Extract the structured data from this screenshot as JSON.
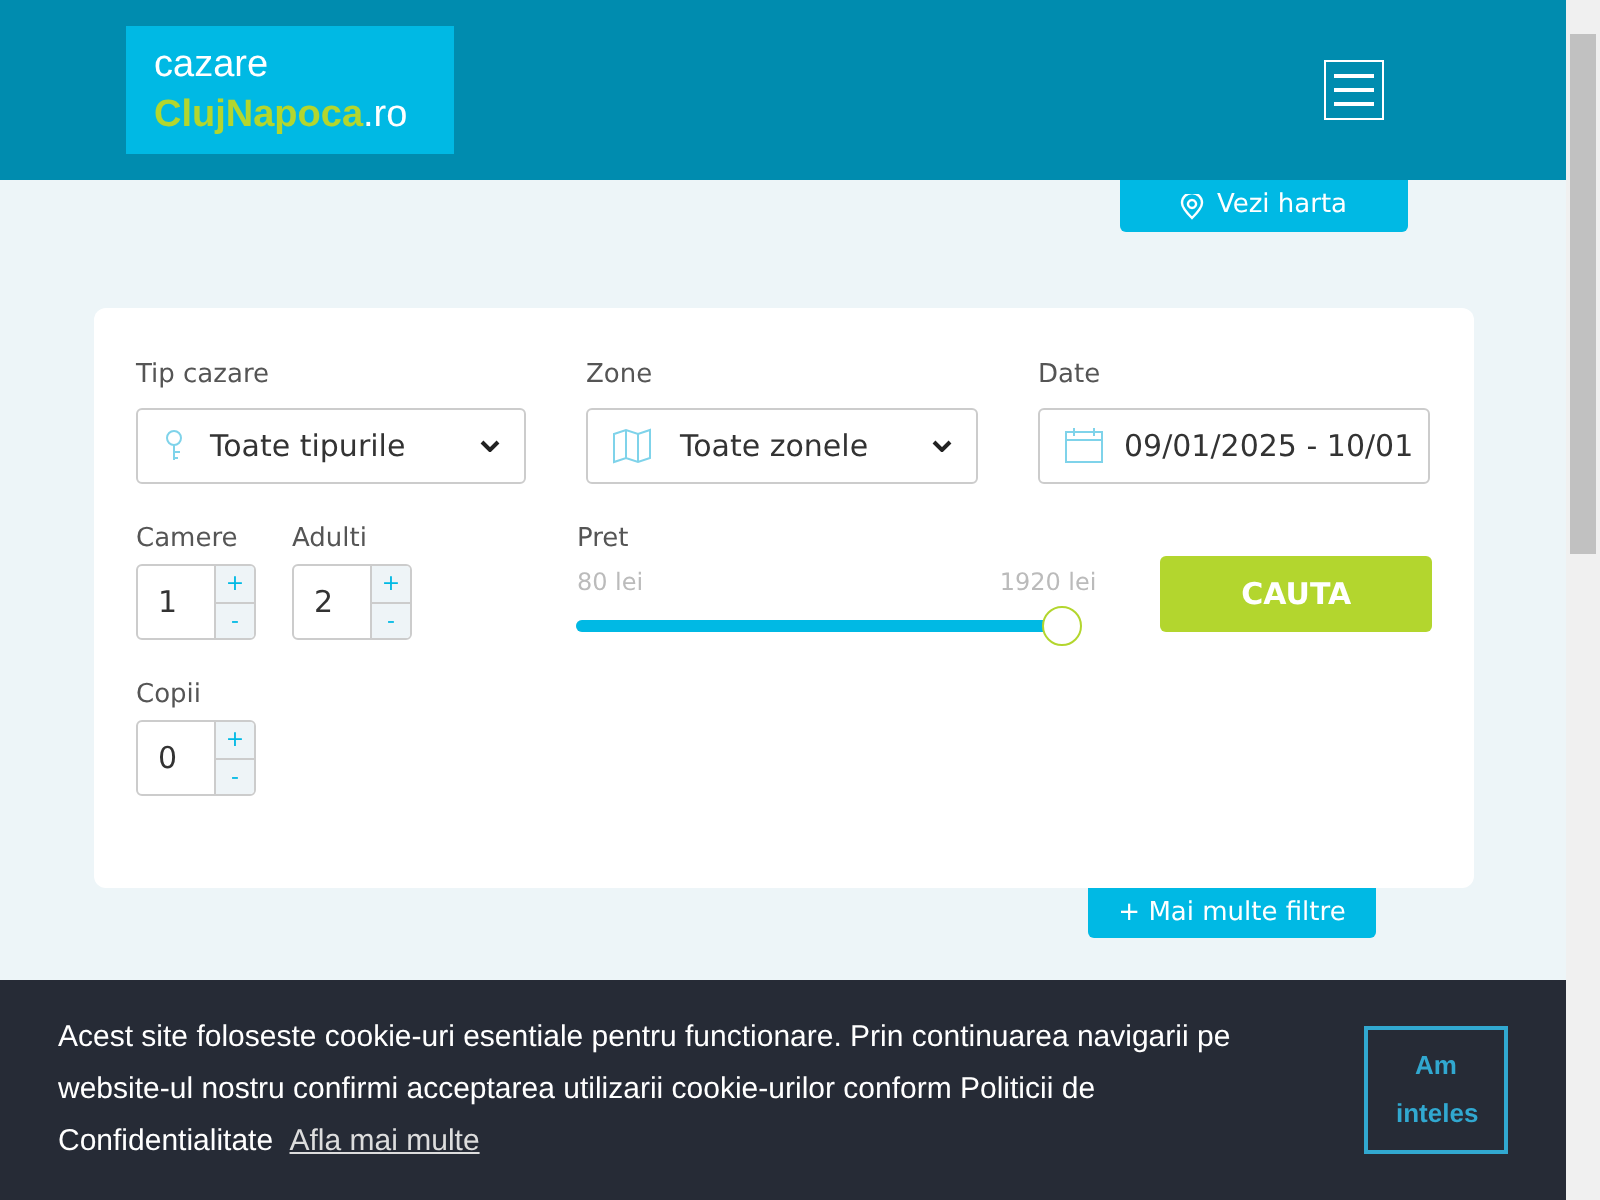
{
  "header": {
    "logo": {
      "line_1": "cazare",
      "brand": "ClujNapoca",
      "suffix": ".ro"
    }
  },
  "map_button": {
    "label": "Vezi harta"
  },
  "search": {
    "type_field": {
      "label": "Tip cazare",
      "value": "Toate tipurile"
    },
    "zone_field": {
      "label": "Zone",
      "value": "Toate zonele"
    },
    "date_field": {
      "label": "Date",
      "value": "09/01/2025 - 10/01"
    },
    "counters": [
      {
        "label": "Camere",
        "value": "1",
        "plus": "+",
        "minus": "-"
      },
      {
        "label": "Adulti",
        "value": "2",
        "plus": "+",
        "minus": "-"
      },
      {
        "label": "Copii",
        "value": "0",
        "plus": "+",
        "minus": "-"
      }
    ],
    "price": {
      "label": "Pret",
      "min": "80 lei",
      "max": "1920 lei",
      "level": 1
    },
    "search_button": "CAUTA",
    "more_filters": "+ Mai multe filtre"
  },
  "cookie_banner": {
    "message": "Acest site foloseste cookie-uri esentiale pentru functionare. Prin continuarea navigarii pe website-ul nostru confirmi acceptarea utilizarii cookie-urilor conform Politicii de Confidentialitate",
    "link": "Afla mai multe",
    "accept": "Am inteles"
  }
}
